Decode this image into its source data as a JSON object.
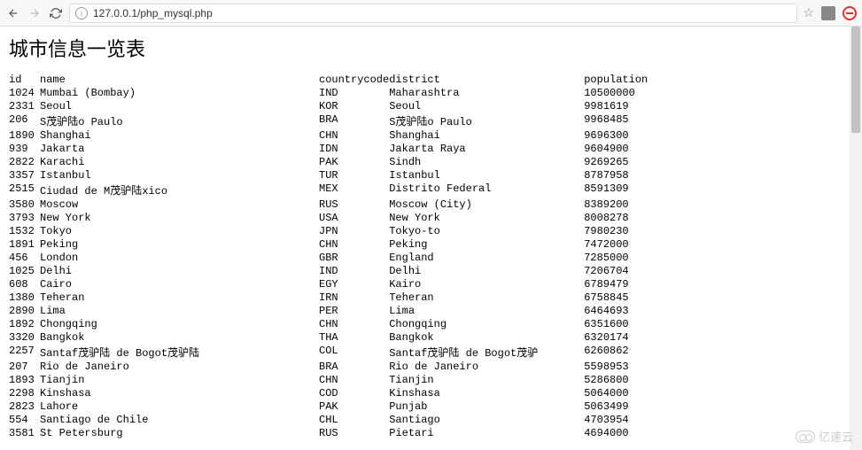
{
  "browser": {
    "url": "127.0.0.1/php_mysql.php"
  },
  "page": {
    "title": "城市信息一览表"
  },
  "table": {
    "headers": {
      "id": "id",
      "name": "name",
      "countrycode": "countrycode",
      "district": "district",
      "population": "population"
    },
    "rows": [
      {
        "id": "1024",
        "name": "Mumbai (Bombay)",
        "countrycode": "IND",
        "district": "Maharashtra",
        "population": "10500000"
      },
      {
        "id": "2331",
        "name": "Seoul",
        "countrycode": "KOR",
        "district": "Seoul",
        "population": "9981619"
      },
      {
        "id": "206",
        "name": "S茂驴陆o Paulo",
        "countrycode": "BRA",
        "district": "S茂驴陆o Paulo",
        "population": "9968485"
      },
      {
        "id": "1890",
        "name": "Shanghai",
        "countrycode": "CHN",
        "district": "Shanghai",
        "population": "9696300"
      },
      {
        "id": "939",
        "name": "Jakarta",
        "countrycode": "IDN",
        "district": "Jakarta Raya",
        "population": "9604900"
      },
      {
        "id": "2822",
        "name": "Karachi",
        "countrycode": "PAK",
        "district": "Sindh",
        "population": "9269265"
      },
      {
        "id": "3357",
        "name": "Istanbul",
        "countrycode": "TUR",
        "district": "Istanbul",
        "population": "8787958"
      },
      {
        "id": "2515",
        "name": "Ciudad de M茂驴陆xico",
        "countrycode": "MEX",
        "district": "Distrito Federal",
        "population": "8591309"
      },
      {
        "id": "3580",
        "name": "Moscow",
        "countrycode": "RUS",
        "district": "Moscow (City)",
        "population": "8389200"
      },
      {
        "id": "3793",
        "name": "New York",
        "countrycode": "USA",
        "district": "New York",
        "population": "8008278"
      },
      {
        "id": "1532",
        "name": "Tokyo",
        "countrycode": "JPN",
        "district": "Tokyo-to",
        "population": "7980230"
      },
      {
        "id": "1891",
        "name": "Peking",
        "countrycode": "CHN",
        "district": "Peking",
        "population": "7472000"
      },
      {
        "id": "456",
        "name": "London",
        "countrycode": "GBR",
        "district": "England",
        "population": "7285000"
      },
      {
        "id": "1025",
        "name": "Delhi",
        "countrycode": "IND",
        "district": "Delhi",
        "population": "7206704"
      },
      {
        "id": "608",
        "name": "Cairo",
        "countrycode": "EGY",
        "district": "Kairo",
        "population": "6789479"
      },
      {
        "id": "1380",
        "name": "Teheran",
        "countrycode": "IRN",
        "district": "Teheran",
        "population": "6758845"
      },
      {
        "id": "2890",
        "name": "Lima",
        "countrycode": "PER",
        "district": "Lima",
        "population": "6464693"
      },
      {
        "id": "1892",
        "name": "Chongqing",
        "countrycode": "CHN",
        "district": "Chongqing",
        "population": "6351600"
      },
      {
        "id": "3320",
        "name": "Bangkok",
        "countrycode": "THA",
        "district": "Bangkok",
        "population": "6320174"
      },
      {
        "id": "2257",
        "name": "Santaf茂驴陆 de Bogot茂驴陆",
        "countrycode": "COL",
        "district": "Santaf茂驴陆 de Bogot茂驴",
        "population": "6260862"
      },
      {
        "id": "207",
        "name": "Rio de Janeiro",
        "countrycode": "BRA",
        "district": "Rio de Janeiro",
        "population": "5598953"
      },
      {
        "id": "1893",
        "name": "Tianjin",
        "countrycode": "CHN",
        "district": "Tianjin",
        "population": "5286800"
      },
      {
        "id": "2298",
        "name": "Kinshasa",
        "countrycode": "COD",
        "district": "Kinshasa",
        "population": "5064000"
      },
      {
        "id": "2823",
        "name": "Lahore",
        "countrycode": "PAK",
        "district": "Punjab",
        "population": "5063499"
      },
      {
        "id": "554",
        "name": "Santiago de Chile",
        "countrycode": "CHL",
        "district": "Santiago",
        "population": "4703954"
      },
      {
        "id": "3581",
        "name": "St Petersburg",
        "countrycode": "RUS",
        "district": "Pietari",
        "population": "4694000"
      }
    ]
  },
  "watermark": {
    "text": "亿速云"
  }
}
